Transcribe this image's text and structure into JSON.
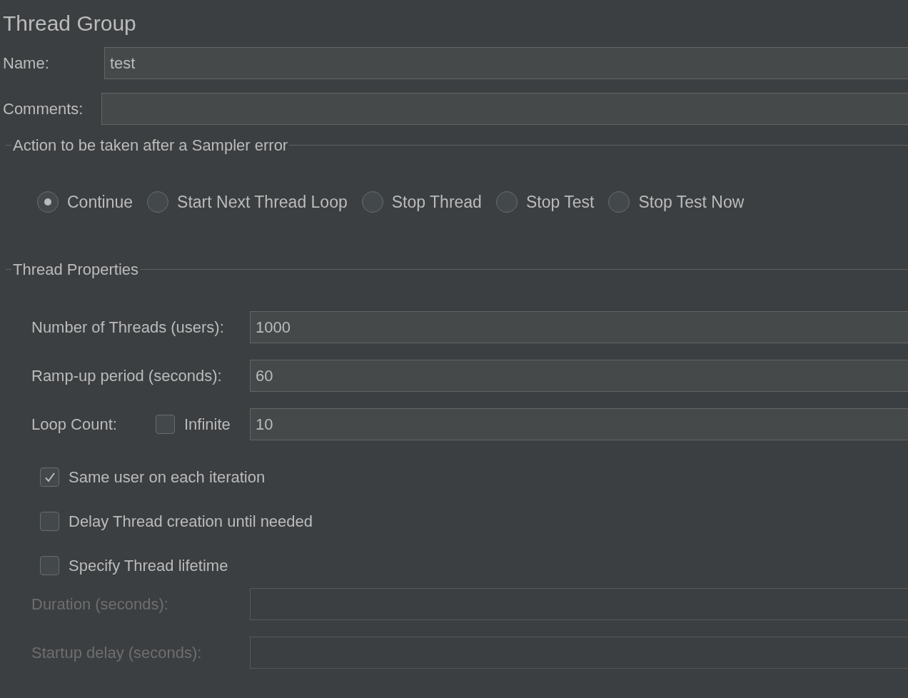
{
  "title": "Thread Group",
  "fields": [
    {
      "label": "Name:",
      "value": "test"
    },
    {
      "label": "Comments:"
    }
  ],
  "sampler_error": {
    "legend": "Action to be taken after a Sampler error",
    "options": [
      {
        "label": "Continue",
        "selected": true
      },
      {
        "label": "Start Next Thread Loop",
        "selected": false
      },
      {
        "label": "Stop Thread",
        "selected": false
      },
      {
        "label": "Stop Test",
        "selected": false
      },
      {
        "label": "Stop Test Now",
        "selected": false
      }
    ]
  },
  "thread_properties": {
    "legend": "Thread Properties",
    "rows": [
      {
        "kind": "field",
        "label": "Number of Threads (users):",
        "value": "1000",
        "disabled": false
      },
      {
        "kind": "field",
        "label": "Ramp-up period (seconds):",
        "value": "60",
        "disabled": false
      },
      {
        "kind": "loop",
        "label": "Loop Count:",
        "infinite_label": "Infinite",
        "infinite_checked": false,
        "value": "10"
      },
      {
        "kind": "checkbox",
        "label": "Same user on each iteration",
        "checked": true
      },
      {
        "kind": "checkbox",
        "label": "Delay Thread creation until needed",
        "checked": false
      },
      {
        "kind": "checkbox",
        "label": "Specify Thread lifetime",
        "checked": false
      },
      {
        "kind": "field",
        "label": "Duration (seconds):",
        "disabled": true
      },
      {
        "kind": "field",
        "label": "Startup delay (seconds):",
        "disabled": true
      }
    ]
  }
}
